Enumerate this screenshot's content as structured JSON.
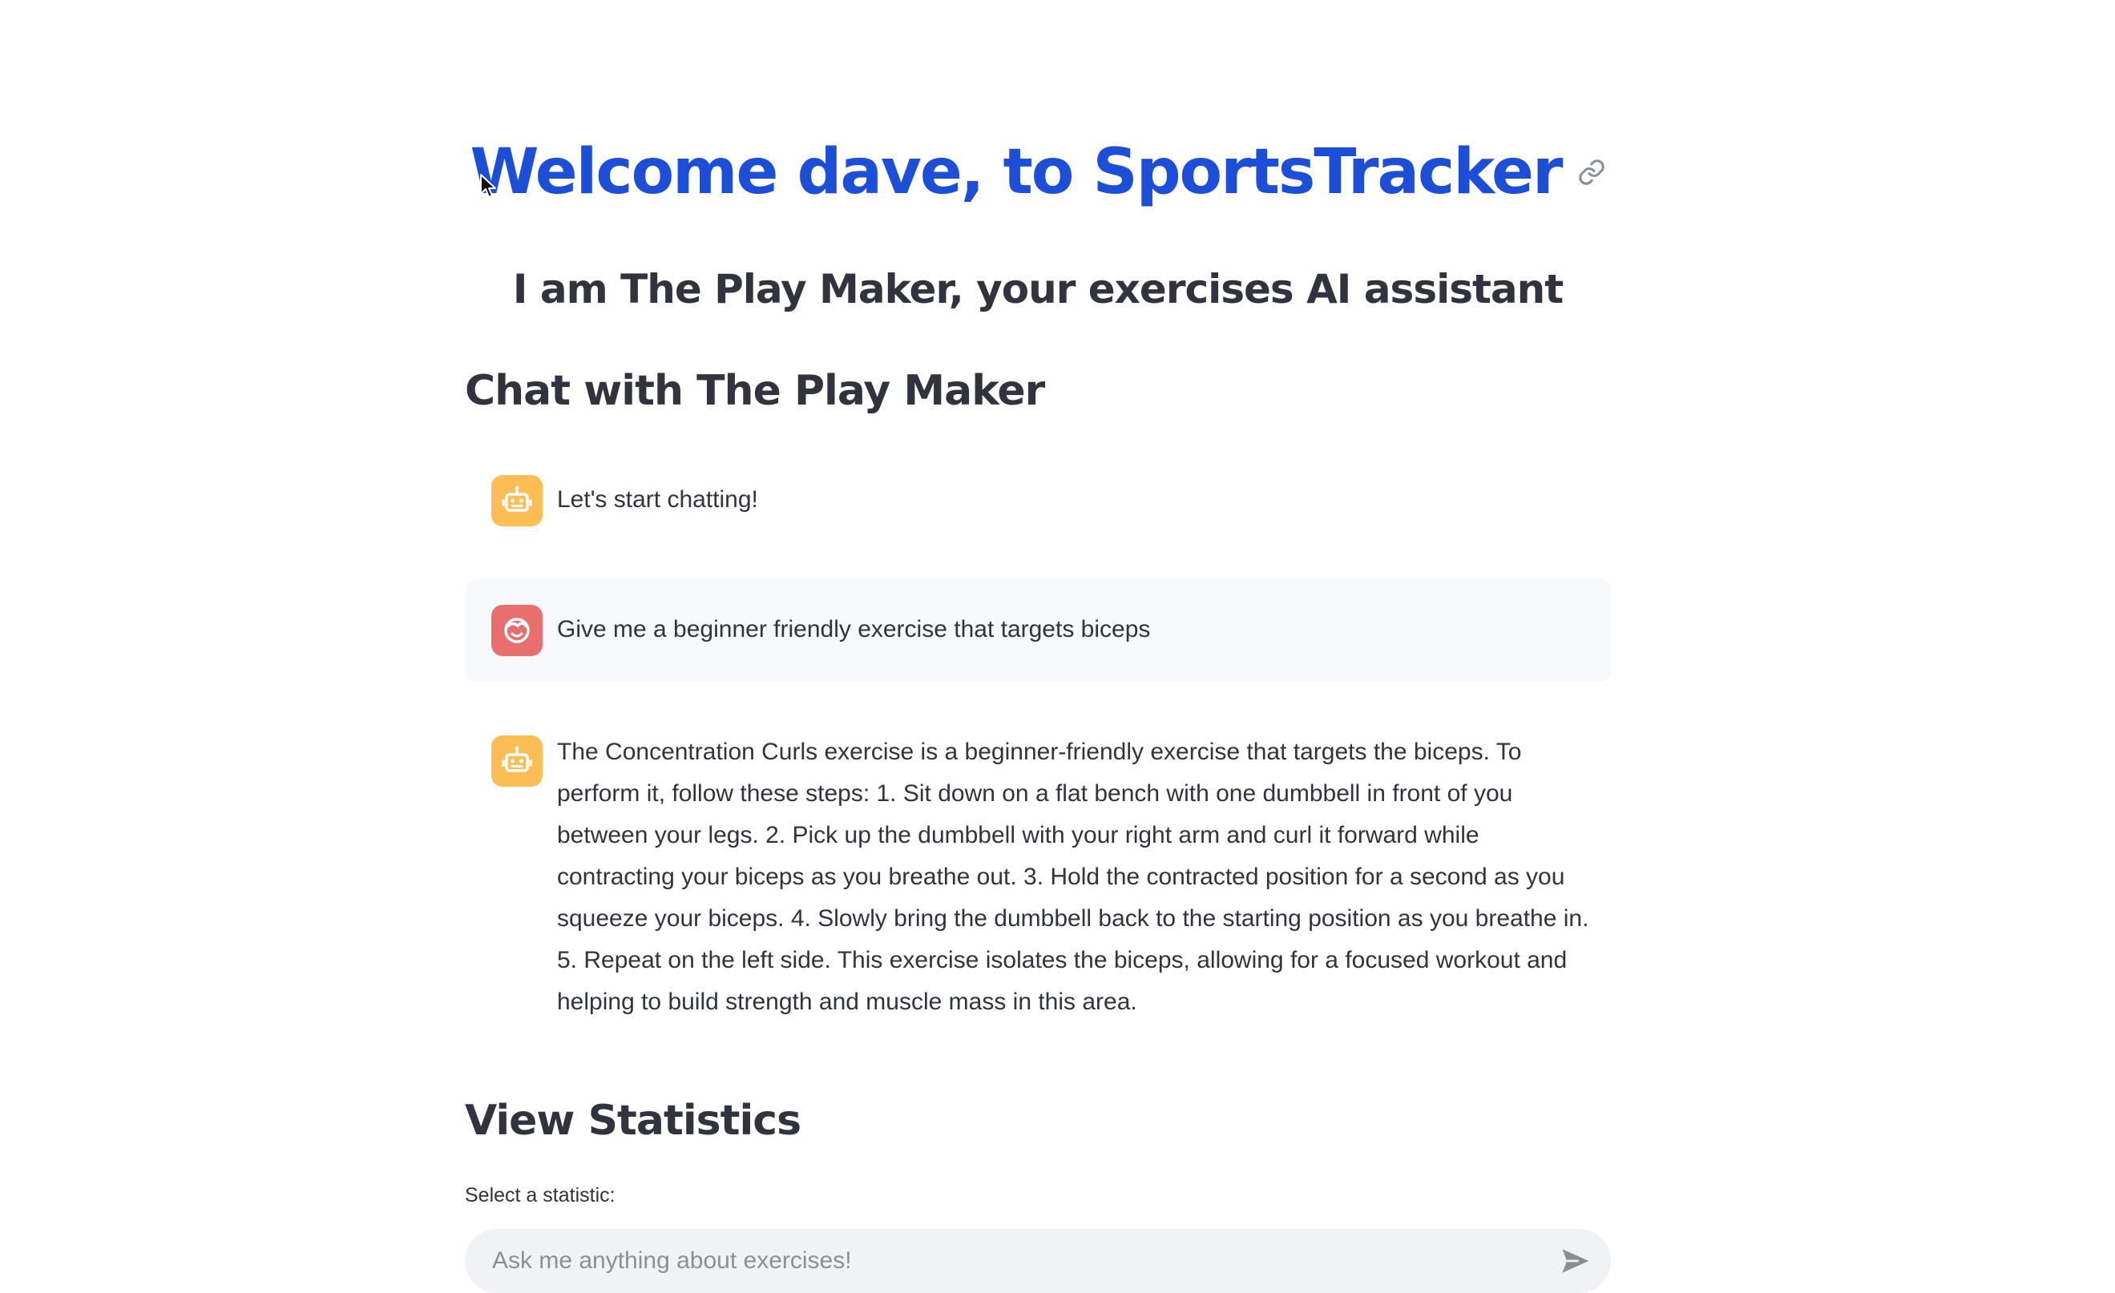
{
  "header": {
    "title": "Welcome dave, to SportsTracker",
    "subtitle": "I am The Play Maker, your exercises AI assistant",
    "link_icon": "link-icon",
    "title_color": "#1d4ed8"
  },
  "chat": {
    "heading": "Chat with The Play Maker",
    "messages": [
      {
        "role": "assistant",
        "avatar_icon": "robot-icon",
        "text": "Let's start chatting!"
      },
      {
        "role": "user",
        "avatar_icon": "user-face-icon",
        "text": "Give me a beginner friendly exercise that targets biceps"
      },
      {
        "role": "assistant",
        "avatar_icon": "robot-icon",
        "text": "The Concentration Curls exercise is a beginner-friendly exercise that targets the biceps. To perform it, follow these steps: 1. Sit down on a flat bench with one dumbbell in front of you between your legs. 2. Pick up the dumbbell with your right arm and curl it forward while contracting your biceps as you breathe out. 3. Hold the contracted position for a second as you squeeze your biceps. 4. Slowly bring the dumbbell back to the starting position as you breathe in. 5. Repeat on the left side. This exercise isolates the biceps, allowing for a focused workout and helping to build strength and muscle mass in this area."
      }
    ],
    "assistant_avatar_color": "#fbbd54",
    "user_avatar_color": "#e96e6e"
  },
  "statistics": {
    "heading": "View Statistics",
    "select_label": "Select a statistic:"
  },
  "chat_input": {
    "placeholder": "Ask me anything about exercises!",
    "value": "",
    "send_icon": "send-icon"
  }
}
